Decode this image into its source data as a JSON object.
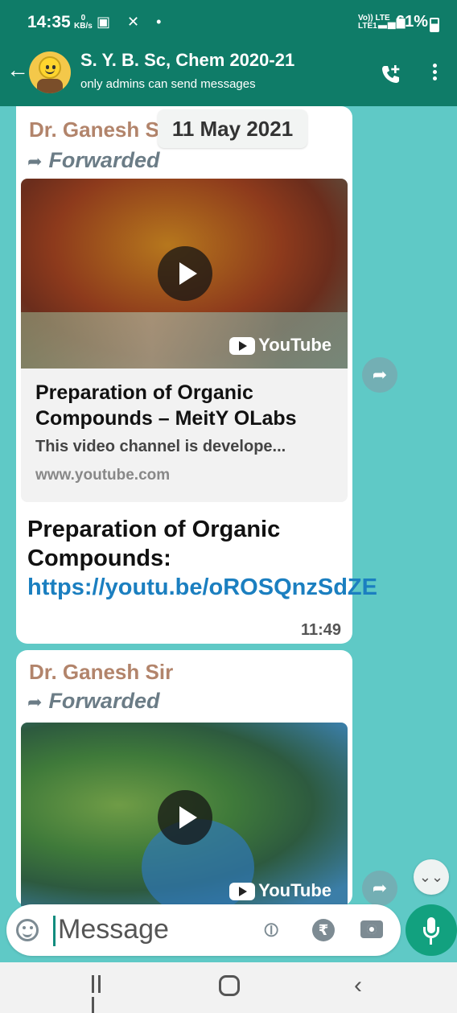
{
  "status_bar": {
    "time": "14:35",
    "speed_value": "0",
    "speed_unit": "KB/s",
    "net_line1": "Vo)) LTE",
    "net_line2": "LTE1",
    "battery": "61%"
  },
  "header": {
    "title": "S. Y. B. Sc, Chem 2020-21",
    "subtitle": "only admins can send messages"
  },
  "date_chip": "11 May 2021",
  "messages": [
    {
      "sender": "Dr. Ganesh S",
      "forwarded_label": "Forwarded",
      "video_source": "YouTube",
      "preview_title": "Preparation of Organic Compounds – MeitY OLabs",
      "preview_desc": "This video channel is develope...",
      "preview_url": "www.youtube.com",
      "text": "Preparation of Organic Compounds: ",
      "link": "https://youtu.be/oROSQnzSdZE",
      "time": "11:49"
    },
    {
      "sender": "Dr. Ganesh Sir",
      "forwarded_label": "Forwarded",
      "video_source": "YouTube"
    }
  ],
  "input": {
    "placeholder": "Message"
  },
  "icons": {
    "back": "arrow-left",
    "call": "add-call",
    "menu": "more-vertical",
    "share": "forward-arrow",
    "scroll": "double-chevron-down",
    "emoji": "smiley",
    "attach": "paperclip",
    "payment": "rupee",
    "camera": "camera",
    "mic": "microphone"
  },
  "colors": {
    "header_bg": "#0f7c68",
    "chat_bg": "#5fc9c6",
    "sender_name": "#b2846b",
    "link": "#1b7fc0",
    "mic_button": "#12a17f"
  }
}
